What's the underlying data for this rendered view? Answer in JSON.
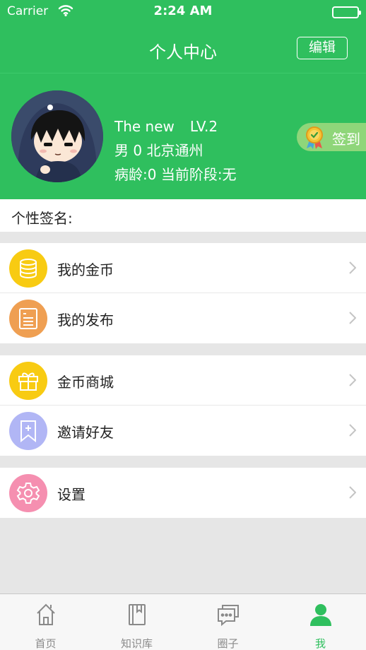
{
  "status_bar": {
    "carrier": "Carrier",
    "time": "2:24 AM"
  },
  "header": {
    "title": "个人中心",
    "edit_label": "编辑"
  },
  "profile": {
    "name": "The new",
    "level": "LV.2",
    "details": "男 0 北京通州",
    "condition": "病龄:0 当前阶段:无",
    "checkin_label": "签到"
  },
  "signature": {
    "label": "个性签名:"
  },
  "menu": {
    "coins": {
      "label": "我的金币",
      "icon": "coins-icon",
      "color": "#f8cb12"
    },
    "posts": {
      "label": "我的发布",
      "icon": "document-icon",
      "color": "#ef9f52"
    },
    "shop": {
      "label": "金币商城",
      "icon": "gift-icon",
      "color": "#f8cb12"
    },
    "invite": {
      "label": "邀请好友",
      "icon": "bookmark-add-icon",
      "color": "#b1b6f5"
    },
    "settings": {
      "label": "设置",
      "icon": "gear-icon",
      "color": "#f58fb0"
    }
  },
  "tabs": [
    {
      "label": "首页",
      "icon": "home-icon",
      "active": false
    },
    {
      "label": "知识库",
      "icon": "book-icon",
      "active": false
    },
    {
      "label": "圈子",
      "icon": "chat-icon",
      "active": false
    },
    {
      "label": "我",
      "icon": "person-icon",
      "active": true
    }
  ],
  "colors": {
    "brand_green": "#2fbf5e",
    "background": "#e6e6e6"
  }
}
